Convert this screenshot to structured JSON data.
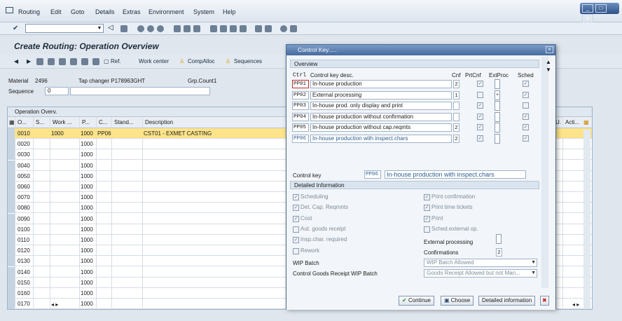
{
  "menu": [
    "Routing",
    "Edit",
    "Goto",
    "Details",
    "Extras",
    "Environment",
    "System",
    "Help"
  ],
  "window_controls": [
    "_",
    "□",
    "x"
  ],
  "page_title": "Create Routing: Operation Overview",
  "app_toolbar": [
    "Ref.",
    "Work center",
    "CompAlloc",
    "Sequences"
  ],
  "header": {
    "material_label": "Material",
    "material_value": "2496",
    "material_desc": "Tap changer P178963GHT",
    "grp_label": "Grp.Count1",
    "sequence_label": "Sequence",
    "sequence_value": "0"
  },
  "grid": {
    "caption": "Operation Overv.",
    "columns": [
      "O...",
      "S...",
      "Work ...",
      "P...",
      "C...",
      "Stand...",
      "Description"
    ],
    "right_columns": [
      "U.",
      "Acti..."
    ],
    "rows": [
      {
        "op": "0010",
        "work": "1000",
        "p": "1000",
        "c": "PP06",
        "desc": "CST01 - EXMET CASTING"
      },
      {
        "op": "0020",
        "p": "1000"
      },
      {
        "op": "0030",
        "p": "1000"
      },
      {
        "op": "0040",
        "p": "1000"
      },
      {
        "op": "0050",
        "p": "1000"
      },
      {
        "op": "0060",
        "p": "1000"
      },
      {
        "op": "0070",
        "p": "1000"
      },
      {
        "op": "0080",
        "p": "1000"
      },
      {
        "op": "0090",
        "p": "1000"
      },
      {
        "op": "0100",
        "p": "1000"
      },
      {
        "op": "0110",
        "p": "1000"
      },
      {
        "op": "0120",
        "p": "1000"
      },
      {
        "op": "0130",
        "p": "1000"
      },
      {
        "op": "0140",
        "p": "1000"
      },
      {
        "op": "0150",
        "p": "1000"
      },
      {
        "op": "0160",
        "p": "1000"
      },
      {
        "op": "0170",
        "p": "1000"
      }
    ]
  },
  "dialog": {
    "title": "Control Key.....",
    "overview_label": "Overview",
    "col_ctrl": "Ctrl",
    "col_desc": "Control key desc.",
    "col_cnf": "Cnf",
    "col_prtcnf": "PrtCnf",
    "col_extproc": "ExtProc",
    "col_sched": "Sched",
    "rows": [
      {
        "code": "PP01",
        "desc": "In-house production",
        "cnf": "2",
        "prtcnf": "✓",
        "ext": "",
        "sched": "✓"
      },
      {
        "code": "PP02",
        "desc": "External processing",
        "cnf": "1",
        "prtcnf": "",
        "ext": "+",
        "sched": "✓"
      },
      {
        "code": "PP03",
        "desc": "In-house prod. only display and print",
        "cnf": "",
        "prtcnf": "✓",
        "ext": "",
        "sched": ""
      },
      {
        "code": "PP04",
        "desc": "In-house production without confirmation",
        "cnf": "",
        "prtcnf": "✓",
        "ext": "",
        "sched": "✓"
      },
      {
        "code": "PP05",
        "desc": "In-house production without cap.reqmts",
        "cnf": "2",
        "prtcnf": "✓",
        "ext": "",
        "sched": "✓"
      },
      {
        "code": "PP06",
        "desc": "In-house production with inspect.chars",
        "cnf": "2",
        "prtcnf": "✓",
        "ext": "",
        "sched": "✓"
      }
    ],
    "control_key_label": "Control key",
    "control_key_value": "PP06",
    "control_key_desc": "In-house production with inspect.chars",
    "detail_label": "Detailed Information",
    "left_checks": [
      {
        "label": "Scheduling",
        "checked": true
      },
      {
        "label": "Det. Cap. Reqmnts",
        "checked": true
      },
      {
        "label": "Cost",
        "checked": true
      },
      {
        "label": "Aut. goods receipt",
        "checked": false
      },
      {
        "label": "Insp.char. required",
        "checked": true
      },
      {
        "label": "Rework",
        "checked": false
      }
    ],
    "right_checks": [
      {
        "label": "Print confirmation",
        "checked": true
      },
      {
        "label": "Print time tickets",
        "checked": true
      },
      {
        "label": "Print",
        "checked": true
      },
      {
        "label": "Sched.external op.",
        "checked": false
      }
    ],
    "external_processing_label": "External processing",
    "confirmations_label": "Confirmations",
    "confirmations_value": "2",
    "wip_batch_label": "WIP Batch",
    "wip_batch_value": "WIP Batch Allowed",
    "cgr_label": "Control Goods Receipt WIP Batch",
    "cgr_value": "Goods Receipt Allowed but not Man...",
    "buttons": {
      "continue": "Continue",
      "choose": "Choose",
      "detailed": "Detailed information",
      "cancel": "✖"
    }
  }
}
